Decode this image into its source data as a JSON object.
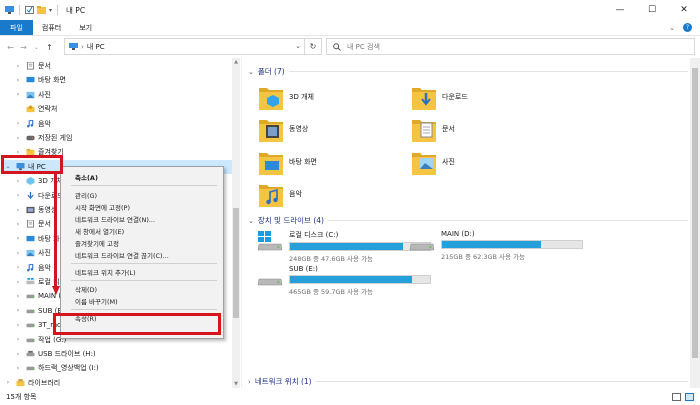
{
  "window": {
    "title": "내 PC",
    "controls": [
      "—",
      "☐",
      "✕"
    ]
  },
  "ribbon": {
    "tabs": [
      "파일",
      "컴퓨터",
      "보기"
    ],
    "help": "?"
  },
  "nav": {
    "address": "내 PC",
    "search_placeholder": "내 PC 검색"
  },
  "tree": {
    "items": [
      {
        "label": "문서",
        "icon": "documents-icon",
        "expand": "›"
      },
      {
        "label": "바탕 화면",
        "icon": "desktop-icon",
        "expand": "›"
      },
      {
        "label": "사진",
        "icon": "pictures-icon",
        "expand": "›"
      },
      {
        "label": "연락처",
        "icon": "contacts-icon",
        "expand": ""
      },
      {
        "label": "음악",
        "icon": "music-icon",
        "expand": "›"
      },
      {
        "label": "저장된 게임",
        "icon": "saved-games-icon",
        "expand": "›"
      },
      {
        "label": "즐겨찾기",
        "icon": "favorites-icon",
        "expand": "›"
      },
      {
        "label": "내 PC",
        "icon": "pc-icon",
        "expand": "⌄",
        "selected": true
      },
      {
        "label": "3D 개체",
        "icon": "3d-objects-icon",
        "expand": "›"
      },
      {
        "label": "다운로드",
        "icon": "downloads-icon",
        "expand": "›"
      },
      {
        "label": "동영상",
        "icon": "videos-icon",
        "expand": "›"
      },
      {
        "label": "문서",
        "icon": "documents-icon",
        "expand": "›"
      },
      {
        "label": "바탕 화면",
        "icon": "desktop-icon",
        "expand": "›"
      },
      {
        "label": "사진",
        "icon": "pictures-icon",
        "expand": "›"
      },
      {
        "label": "음악",
        "icon": "music-icon",
        "expand": "›"
      },
      {
        "label": "로컬 디스크 (C:)",
        "icon": "windows-drive-icon",
        "expand": "›"
      },
      {
        "label": "MAIN (D:)",
        "icon": "drive-icon",
        "expand": "›"
      },
      {
        "label": "SUB (E:)",
        "icon": "drive-icon",
        "expand": "›"
      },
      {
        "label": "3T_mov (F:)",
        "icon": "drive-icon",
        "expand": "›"
      },
      {
        "label": "작업 (G:)",
        "icon": "drive-icon",
        "expand": "›"
      },
      {
        "label": "USB 드라이브 (H:)",
        "icon": "usb-drive-icon",
        "expand": "›"
      },
      {
        "label": "하드랙_영상백업 (I:)",
        "icon": "drive-icon",
        "expand": "›"
      },
      {
        "label": "라이브러리",
        "icon": "library-icon",
        "expand": "›"
      }
    ]
  },
  "context_menu": {
    "items": [
      {
        "label": "축소(A)",
        "bold": true
      },
      {
        "sep": true
      },
      {
        "label": "관리(G)"
      },
      {
        "label": "시작 화면에 고정(P)"
      },
      {
        "label": "네트워크 드라이브 연결(N)..."
      },
      {
        "label": "새 창에서 열기(E)"
      },
      {
        "label": "즐겨찾기에 고정"
      },
      {
        "label": "네트워크 드라이브 연결 끊기(C)..."
      },
      {
        "sep": true
      },
      {
        "label": "네트워크 위치 추가(L)"
      },
      {
        "sep": true
      },
      {
        "label": "삭제(D)"
      },
      {
        "label": "이름 바꾸기(M)"
      },
      {
        "sep": true
      },
      {
        "label": "속성(R)"
      }
    ]
  },
  "content": {
    "folders_header": "폴더 (7)",
    "folders": [
      {
        "label": "3D 개체",
        "icon": "3d-objects-folder-icon"
      },
      {
        "label": "다운로드",
        "icon": "downloads-folder-icon"
      },
      {
        "label": "동영상",
        "icon": "videos-folder-icon"
      },
      {
        "label": "문서",
        "icon": "documents-folder-icon"
      },
      {
        "label": "바탕 화면",
        "icon": "desktop-folder-icon"
      },
      {
        "label": "사진",
        "icon": "pictures-folder-icon"
      },
      {
        "label": "음악",
        "icon": "music-folder-icon"
      }
    ],
    "drives_header": "장치 및 드라이브 (4)",
    "drives": [
      {
        "name": "로컬 디스크 (C:)",
        "size": "248GB 중 47.6GB 사용 가능",
        "used_fraction": 0.81,
        "icon": "windows-drive-icon"
      },
      {
        "name": "MAIN (D:)",
        "size": "215GB 중 62.3GB 사용 가능",
        "used_fraction": 0.71,
        "icon": "drive-icon"
      },
      {
        "name": "SUB (E:)",
        "size": "465GB 중 59.7GB 사용 가능",
        "used_fraction": 0.87,
        "icon": "drive-icon"
      }
    ],
    "network_header": "네트워크 위치 (1)"
  },
  "status": {
    "count": "15개 항목"
  },
  "colors": {
    "accent": "#1979ca",
    "selection": "#cce8ff",
    "bar_fill": "#26a0da",
    "annotation": "#d4141e",
    "folder": "#f6c443"
  }
}
